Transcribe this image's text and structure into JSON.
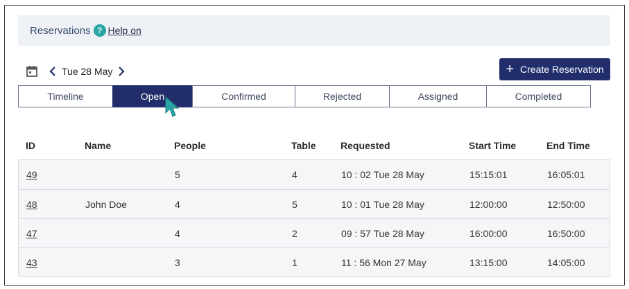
{
  "header": {
    "title": "Reservations",
    "help_icon": "?",
    "help_link": "Help on"
  },
  "date_nav": {
    "date": "Tue 28 May",
    "calendar_icon": "calendar-icon",
    "prev_icon": "chevron-left-icon",
    "next_icon": "chevron-right-icon"
  },
  "create_button": {
    "icon": "+",
    "label": "Create Reservation"
  },
  "tabs": [
    {
      "label": "Timeline"
    },
    {
      "label": "Open",
      "active": true
    },
    {
      "label": "Confirmed"
    },
    {
      "label": "Rejected"
    },
    {
      "label": "Assigned"
    },
    {
      "label": "Completed"
    }
  ],
  "table": {
    "columns": [
      "ID",
      "Name",
      "People",
      "Table",
      "Requested",
      "Start Time",
      "End Time"
    ],
    "rows": [
      {
        "id": "49",
        "name": "",
        "people": "5",
        "table": "4",
        "requested": "10 : 02 Tue 28 May",
        "start": "15:15:01",
        "end": "16:05:01"
      },
      {
        "id": "48",
        "name": "John Doe",
        "people": "4",
        "table": "5",
        "requested": "10 : 01 Tue 28 May",
        "start": "12:00:00",
        "end": "12:50:00"
      },
      {
        "id": "47",
        "name": "",
        "people": "4",
        "table": "2",
        "requested": "09 : 57 Tue 28 May",
        "start": "16:00:00",
        "end": "16:50:00"
      },
      {
        "id": "43",
        "name": "",
        "people": "3",
        "table": "1",
        "requested": "11 : 56 Mon 27 May",
        "start": "13:15:00",
        "end": "14:05:00"
      }
    ]
  },
  "colors": {
    "primary": "#222e6b",
    "help": "#2aa5a5",
    "header_bg": "#eef2f6",
    "row_bg": "#f5f6f8",
    "cursor": "#2aa5a5"
  }
}
